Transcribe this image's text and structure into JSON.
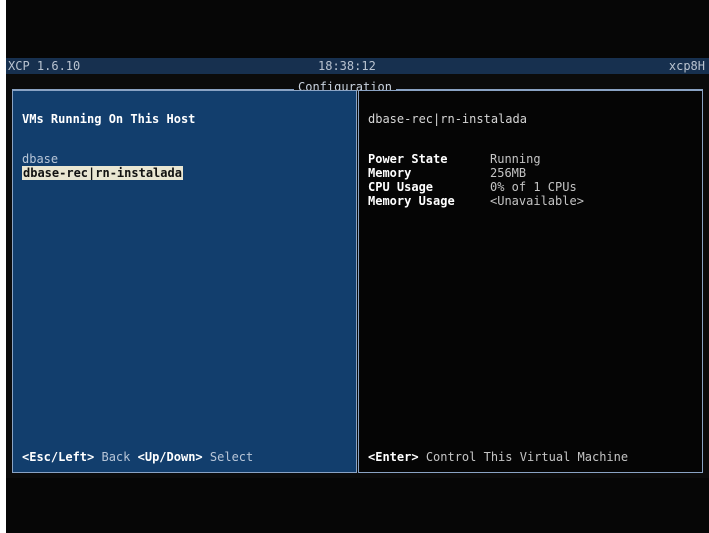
{
  "status_bar": {
    "version": "XCP 1.6.10",
    "time": "18:38:12",
    "hostname": "xcp8H"
  },
  "frame": {
    "title": "Configuration"
  },
  "left_panel": {
    "title": "VMs Running On This Host",
    "vms": [
      {
        "name": "dbase",
        "selected": false
      },
      {
        "name": "dbase-rec|rn-instalada",
        "selected": true
      }
    ],
    "footer": {
      "esc_key": "<Esc/Left>",
      "esc_action": "Back",
      "updown_key": "<Up/Down>",
      "updown_action": "Select"
    }
  },
  "right_panel": {
    "vm_title": "dbase-rec|rn-instalada",
    "details": [
      {
        "label": "Power State",
        "value": "Running"
      },
      {
        "label": "Memory",
        "value": "256MB"
      },
      {
        "label": "CPU Usage",
        "value": "0% of 1 CPUs"
      },
      {
        "label": "Memory Usage",
        "value": "<Unavailable>"
      }
    ],
    "footer": {
      "enter_key": "<Enter>",
      "enter_action": "Control This Virtual Machine"
    }
  },
  "colors": {
    "left_panel_bg": "#123e6d",
    "right_panel_bg": "#050505",
    "selection_bg": "#e9e6d2",
    "status_bar_bg": "#17304f"
  }
}
